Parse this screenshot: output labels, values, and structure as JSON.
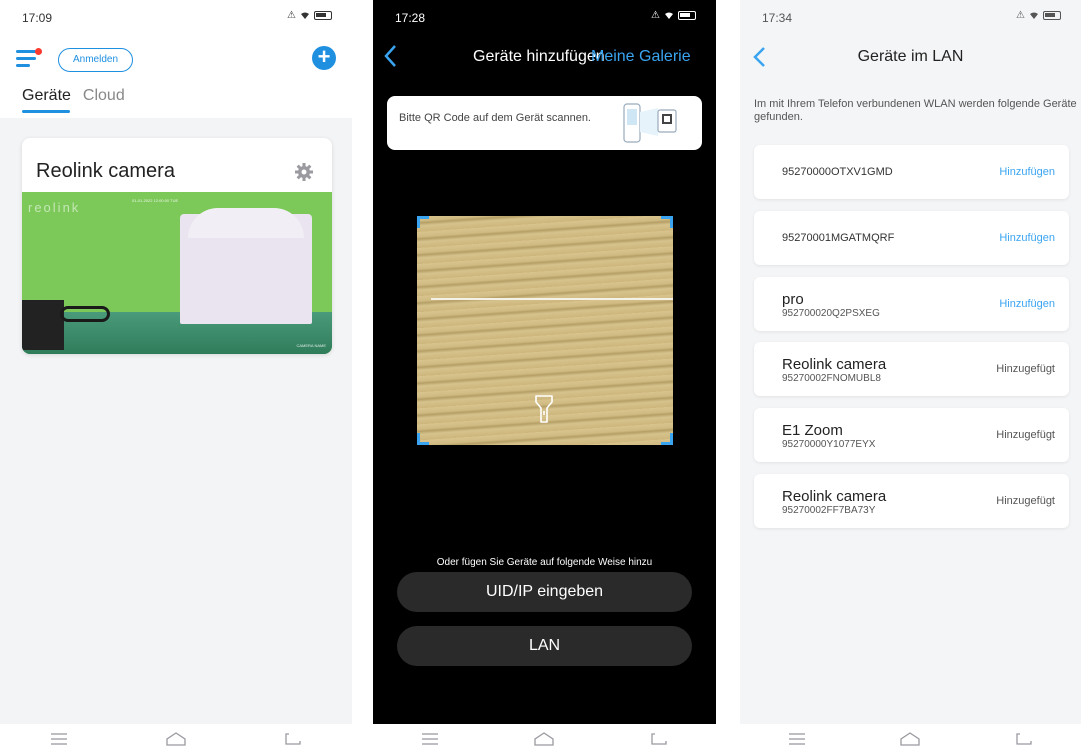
{
  "panels": {
    "home": {
      "status_time": "17:09",
      "login_label": "Anmelden",
      "tabs": [
        "Geräte",
        "Cloud"
      ],
      "camera": {
        "title": "Reolink camera",
        "watermark": "reolink",
        "osd_top": "01-01-2022 12:00:00 TUE",
        "osd_bottom": "CAMERA NAME"
      }
    },
    "scan": {
      "status_time": "17:28",
      "title": "Geräte hinzufügen",
      "gallery_label": "Meine Galerie",
      "hint": "Bitte QR Code auf dem Gerät scannen.",
      "alternative_text": "Oder fügen Sie Geräte auf folgende Weise hinzu",
      "uid_button": "UID/IP eingeben",
      "lan_button": "LAN"
    },
    "lan": {
      "status_time": "17:34",
      "title": "Geräte im LAN",
      "description": "Im mit Ihrem Telefon verbundenen WLAN werden folgende Geräte gefunden.",
      "devices": [
        {
          "name": "",
          "uid": "95270000OTXV1GMD",
          "action": "Hinzufügen"
        },
        {
          "name": "",
          "uid": "95270001MGATMQRF",
          "action": "Hinzufügen"
        },
        {
          "name": "pro",
          "uid": "952700020Q2PSXEG",
          "action": "Hinzufügen"
        },
        {
          "name": "Reolink camera",
          "uid": "95270002FNOMUBL8",
          "action": "Hinzugefügt"
        },
        {
          "name": "E1 Zoom",
          "uid": "95270000Y1077EYX",
          "action": "Hinzugefügt"
        },
        {
          "name": "Reolink camera",
          "uid": "95270002FF7BA73Y",
          "action": "Hinzugefügt"
        }
      ]
    }
  },
  "colors": {
    "accent": "#1f8fe0",
    "link": "#3aa4f0",
    "scan_background": "#000000",
    "dark_button": "#2a2a2a"
  },
  "icons": {
    "menu": "hamburger-menu-icon",
    "add": "plus-circle-icon",
    "settings": "gear-icon",
    "back": "chevron-left-icon",
    "torch": "flashlight-icon",
    "nav": [
      "menu-icon",
      "home-icon",
      "back-icon"
    ]
  }
}
